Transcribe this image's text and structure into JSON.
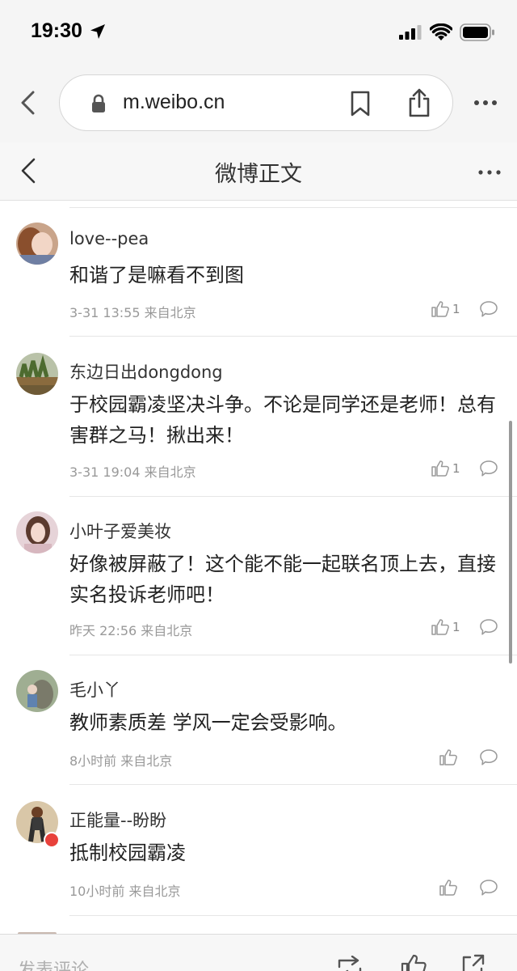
{
  "status_bar": {
    "time": "19:30"
  },
  "browser": {
    "url": "m.weibo.cn"
  },
  "header": {
    "title": "微博正文"
  },
  "comments": [
    {
      "user": "love--pea",
      "text": "和谐了是嘛看不到图",
      "time": "3-31 13:55 来自北京",
      "likes": "1"
    },
    {
      "user": "东边日出dongdong",
      "text": "于校园霸凌坚决斗争。不论是同学还是老师！总有害群之马！揪出来！",
      "time": "3-31 19:04 来自北京",
      "likes": "1"
    },
    {
      "user": "小叶子爱美妆",
      "text": "好像被屏蔽了！这个能不能一起联名顶上去，直接实名投诉老师吧！",
      "time": "昨天 22:56 来自北京",
      "likes": "1"
    },
    {
      "user": "毛小丫",
      "text": "教师素质差 学风一定会受影响。",
      "time": "8小时前 来自北京",
      "likes": ""
    },
    {
      "user": "正能量--盼盼",
      "text": "抵制校园霸凌",
      "time": "10小时前 来自北京",
      "likes": ""
    }
  ],
  "bottom_bar": {
    "comment_placeholder": "发表评论"
  },
  "colors": {
    "vip_badge": "#e8413b",
    "icon_gray": "#999999"
  }
}
